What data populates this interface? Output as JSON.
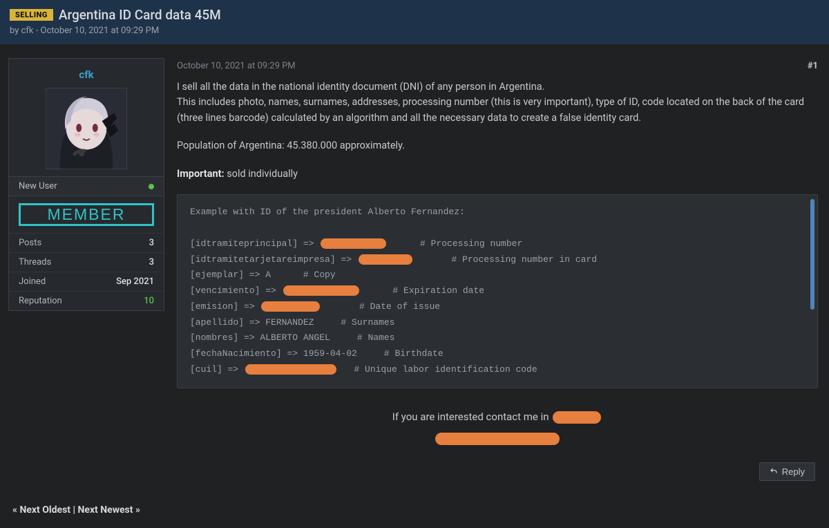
{
  "header": {
    "tag": "SELLING",
    "title": "Argentina ID Card data 45M",
    "byline": "by cfk - October 10, 2021 at 09:29 PM"
  },
  "user": {
    "name": "cfk",
    "status": "New User",
    "badge": "MEMBER",
    "stats": {
      "posts_label": "Posts",
      "posts": "3",
      "threads_label": "Threads",
      "threads": "3",
      "joined_label": "Joined",
      "joined": "Sep 2021",
      "rep_label": "Reputation",
      "rep": "10"
    }
  },
  "post": {
    "timestamp": "October 10, 2021 at 09:29 PM",
    "number": "#1",
    "p1": "I sell all the data in the national identity document (DNI) of any person in Argentina.",
    "p2": "This includes photo, names, surnames, addresses, processing number (this is very important), type of ID, code located on the back of the card (three lines barcode) calculated by an algorithm and all the necessary data to create a false identity card.",
    "p3": "Population of Argentina: 45.380.000 approximately.",
    "important_label": "Important:",
    "important_text": " sold individually",
    "code_intro": "Example with ID of the president Alberto Fernandez:",
    "code_lines": {
      "l1a": "[idtramiteprincipal] => ",
      "l1b": "      # Processing number",
      "l2a": "[idtramitetarjetareimpresa] => ",
      "l2b": "       # Processing number in card",
      "l3": "[ejemplar] => A      # Copy",
      "l4a": "[vencimiento] => ",
      "l4b": "      # Expiration date",
      "l5a": "[emision] => ",
      "l5b": "       # Date of issue",
      "l6": "[apellido] => FERNANDEZ     # Surnames",
      "l7": "[nombres] => ALBERTO ANGEL     # Names",
      "l8": "[fechaNacimiento] => 1959-04-02     # Birthdate",
      "l9a": "[cuil] => ",
      "l9b": "   # Unique labor identification code"
    },
    "contact_text": "If you are interested contact me in ",
    "reply_label": "Reply"
  },
  "footer": {
    "laquo": "« ",
    "prev": "Next Oldest",
    "sep": " | ",
    "next": "Next Newest",
    "raquo": " »"
  }
}
